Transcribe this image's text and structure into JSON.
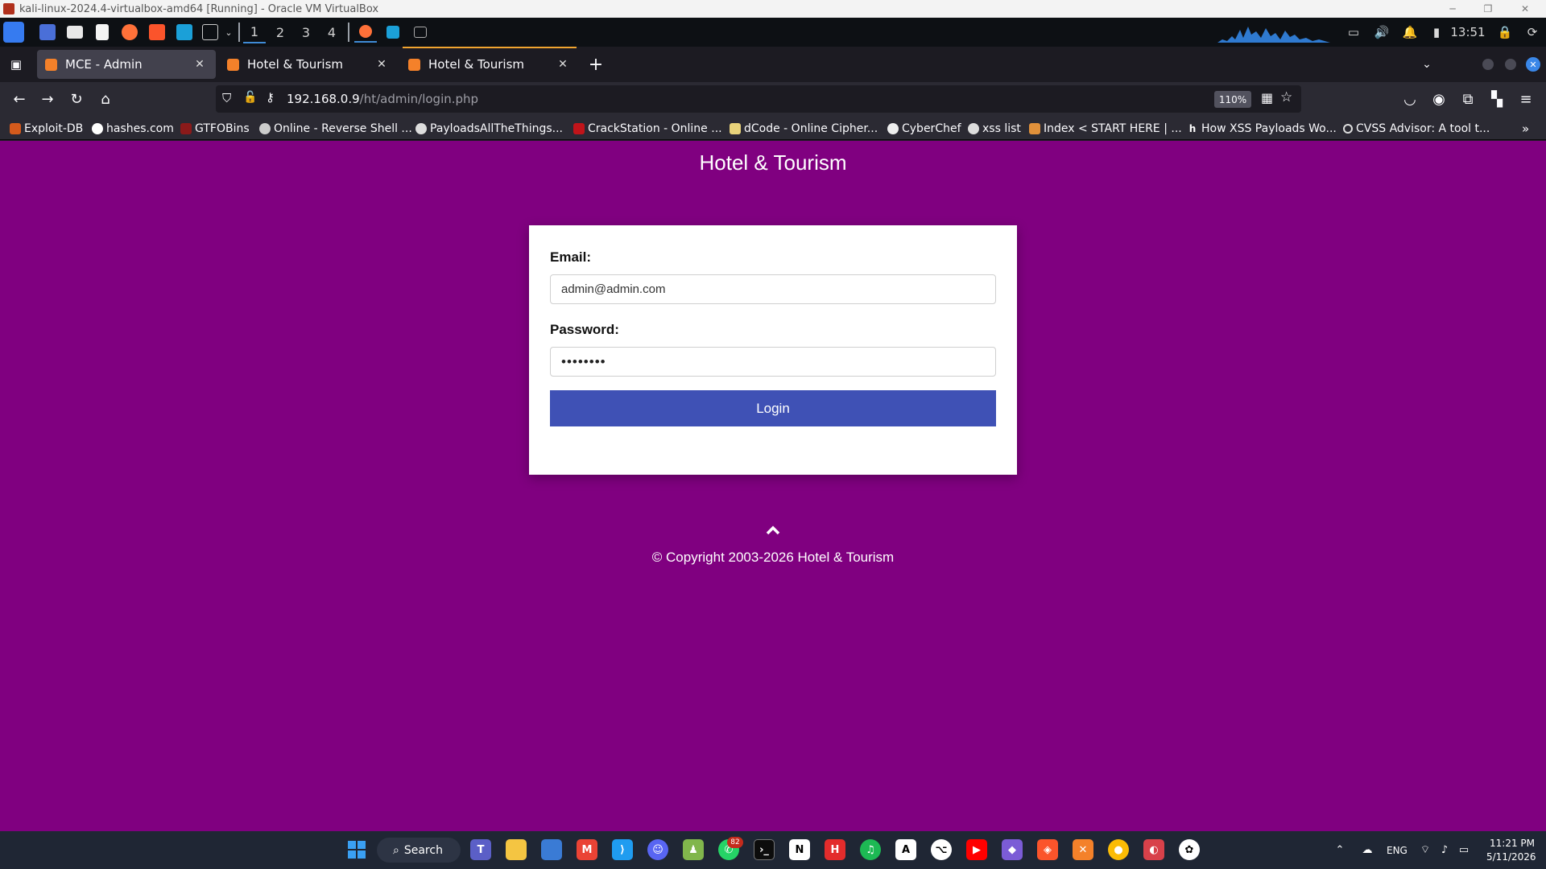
{
  "vbox": {
    "title": "kali-linux-2024.4-virtualbox-amd64 [Running] - Oracle VM VirtualBox"
  },
  "kali_panel": {
    "workspaces": [
      "1",
      "2",
      "3",
      "4"
    ],
    "clock": "13:51"
  },
  "browser": {
    "tabs": [
      {
        "label": "MCE - Admin"
      },
      {
        "label": "Hotel & Tourism"
      },
      {
        "label": "Hotel & Tourism"
      }
    ],
    "url": {
      "host": "192.168.0.9",
      "path": "/ht/admin/login.php"
    },
    "zoom": "110%",
    "bookmarks": [
      "Exploit-DB",
      "hashes.com",
      "GTFOBins",
      "Online - Reverse Shell ...",
      "PayloadsAllTheThings...",
      "CrackStation - Online ...",
      "dCode - Online Cipher...",
      "CyberChef",
      "xss list",
      "Index < START HERE | ...",
      "How XSS Payloads Wo...",
      "CVSS Advisor: A tool t..."
    ]
  },
  "page": {
    "site_title": "Hotel & Tourism",
    "form": {
      "email_label": "Email:",
      "email_value": "admin@admin.com",
      "password_label": "Password:",
      "password_mask": "••••••••",
      "login_label": "Login"
    },
    "copyright": "© Copyright 2003-2026 Hotel & Tourism",
    "background_color": "#800080"
  },
  "taskbar": {
    "search_label": "Search",
    "whatsapp_badge": "82",
    "lang": "ENG",
    "time": "11:21 PM",
    "date": "5/11/2026"
  }
}
